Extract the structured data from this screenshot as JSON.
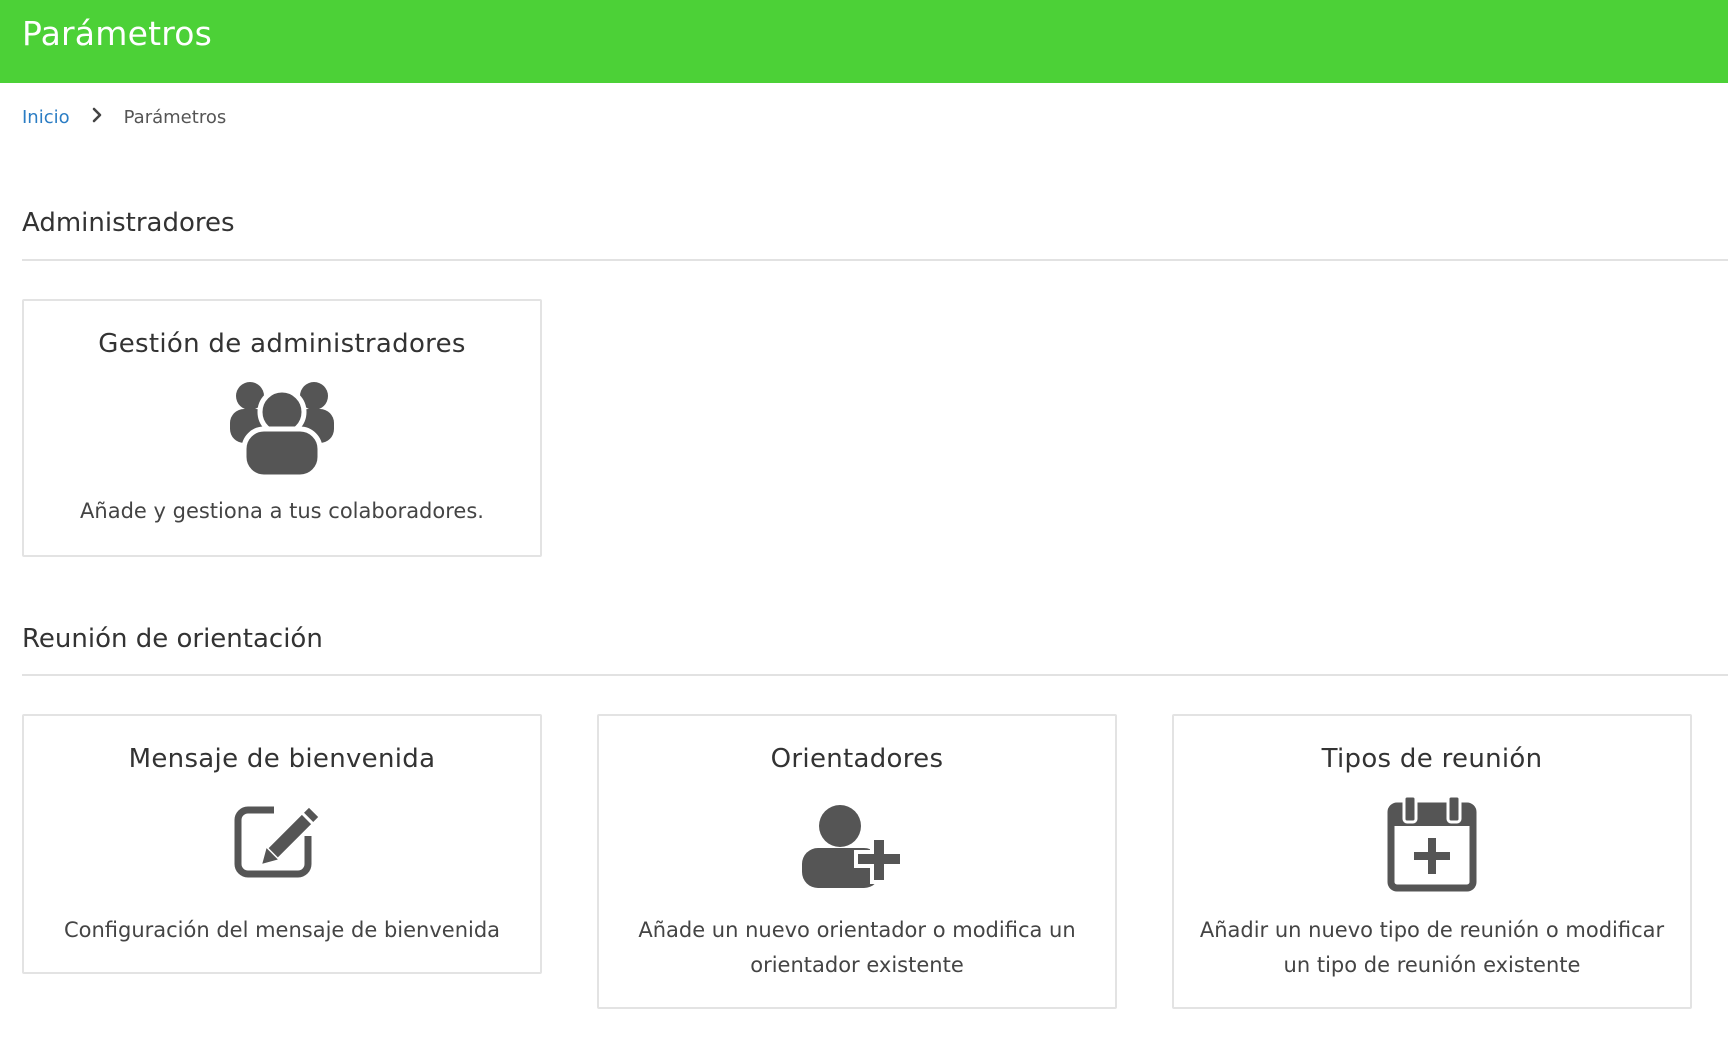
{
  "header": {
    "title": "Parámetros",
    "color": "#4cd137"
  },
  "breadcrumb": {
    "home": "Inicio",
    "separator_icon": "chevron-right-icon",
    "current": "Parámetros"
  },
  "sections": [
    {
      "title": "Administradores",
      "cards": [
        {
          "title": "Gestión de administradores",
          "icon": "users-group-icon",
          "description": "Añade y gestiona a tus colaboradores."
        }
      ]
    },
    {
      "title": "Reunión de orientación",
      "cards": [
        {
          "title": "Mensaje de bienvenida",
          "icon": "edit-icon",
          "description": "Configuración del mensaje de bienvenida"
        },
        {
          "title": "Orientadores",
          "icon": "user-plus-icon",
          "description": "Añade un nuevo orientador o modifica un orientador existente"
        },
        {
          "title": "Tipos de reunión",
          "icon": "calendar-plus-icon",
          "description": "Añadir un nuevo tipo de reunión o modificar un tipo de reunión existente"
        }
      ]
    }
  ],
  "colors": {
    "link": "#2b7dc4",
    "icon": "#555555",
    "card_border": "#e3e3e3"
  }
}
